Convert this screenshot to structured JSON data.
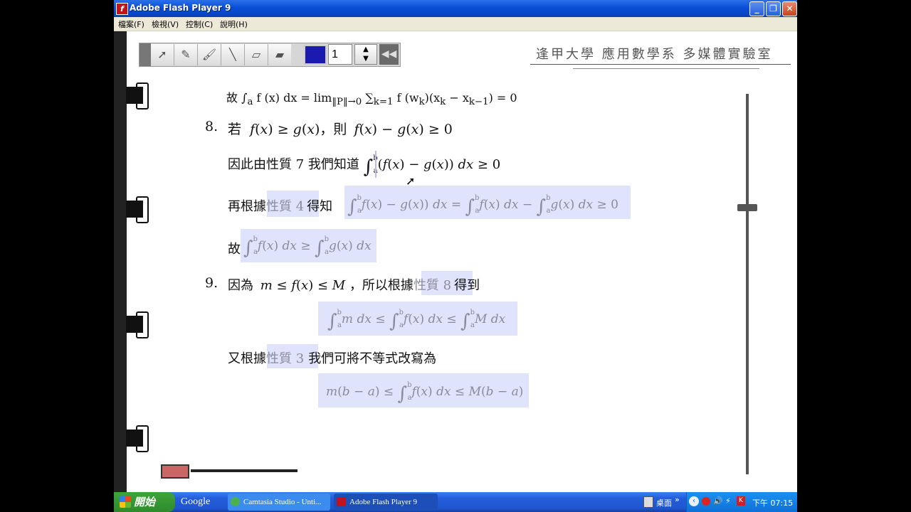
{
  "window": {
    "title": "Adobe Flash Player 9",
    "icon": "flash-icon",
    "controls": [
      "minimize",
      "maximize",
      "close"
    ]
  },
  "menu": [
    "檔案(F)",
    "檢視(V)",
    "控制(C)",
    "說明(H)"
  ],
  "toolbar": {
    "tools": [
      "pointer-icon",
      "pencil-icon",
      "brush-icon",
      "line-icon",
      "eraser-icon",
      "clear-eraser-icon"
    ],
    "pen_color": "#1a1ab0",
    "pen_size": "1",
    "rewind_label": "◀◀"
  },
  "header": {
    "text": "逢甲大學  應用數學系  多媒體實驗室"
  },
  "content": {
    "item8_num": "8.",
    "item8_line1_a": "若",
    "item8_line1_b": "，則",
    "item8_line2_a": "因此由性質 7 我們知道",
    "item8_line3_a": "再根據",
    "item8_line3_hl": "性質 4",
    "item8_line3_b": "得知",
    "item8_line4_a": "故",
    "item9_num": "9.",
    "item9_line1_a": "因為",
    "item9_line1_b": "，所以根據",
    "item9_line1_hl": "性質 8",
    "item9_line1_c": "得到",
    "item9_line3_a": "又根據",
    "item9_line3_hl": "性質 3",
    "item9_line3_b": "我們可將不等式改寫為"
  },
  "taskbar": {
    "start": "開始",
    "google": "Google",
    "tasks": [
      "Camtasia Studio - Unti...",
      "Adobe Flash Player 9"
    ],
    "tray_desktop": "桌面",
    "clock": "下午 07:15"
  }
}
